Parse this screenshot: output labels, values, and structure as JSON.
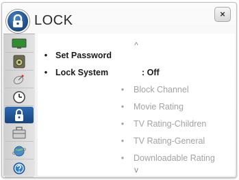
{
  "header": {
    "title": "LOCK",
    "close_label": "×"
  },
  "sidebar": {
    "items": [
      {
        "icon": "tv-screen-icon",
        "active": false
      },
      {
        "icon": "speaker-icon",
        "active": false
      },
      {
        "icon": "satellite-dish-icon",
        "active": false
      },
      {
        "icon": "clock-icon",
        "active": false
      },
      {
        "icon": "lock-icon",
        "active": true
      },
      {
        "icon": "briefcase-icon",
        "active": false
      },
      {
        "icon": "network-globe-icon",
        "active": false
      },
      {
        "icon": "help-icon",
        "active": false
      }
    ]
  },
  "menu": {
    "scroll_up": "^",
    "scroll_down": "v",
    "set_password": "Set Password",
    "lock_system": "Lock System",
    "lock_system_value": ": Off",
    "bullet": "•",
    "sub_items": [
      "Block Channel",
      "Movie Rating",
      "TV Rating-Children",
      "TV Rating-General",
      "Downloadable Rating"
    ]
  },
  "colors": {
    "accent": "#1f5598",
    "disabled_text": "#a3a3a3"
  }
}
